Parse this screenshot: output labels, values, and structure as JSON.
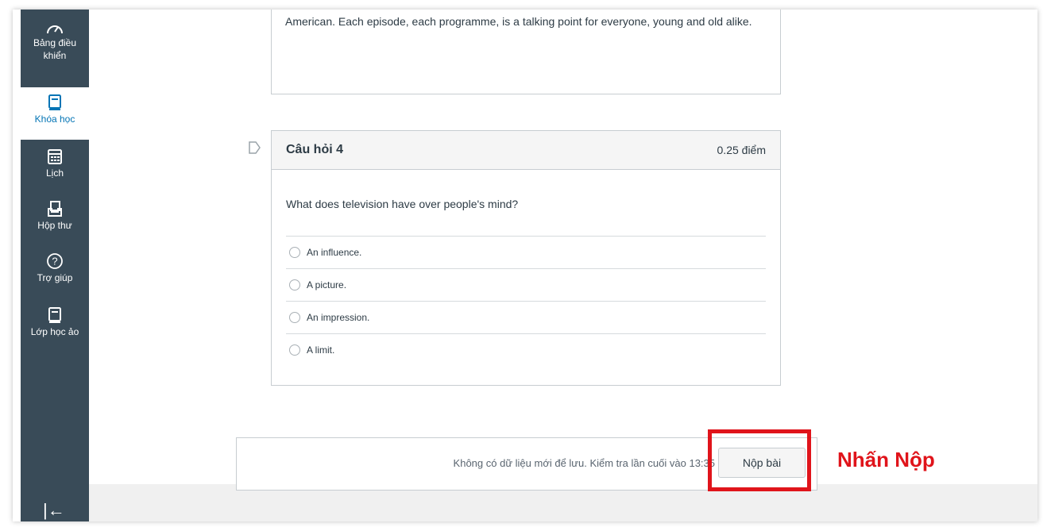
{
  "sidebar": {
    "items": [
      {
        "label": "Bảng điều khiển",
        "icon": "dashboard-icon"
      },
      {
        "label": "Khóa học",
        "icon": "courses-icon",
        "active": true
      },
      {
        "label": "Lịch",
        "icon": "calendar-icon"
      },
      {
        "label": "Hộp thư",
        "icon": "inbox-icon"
      },
      {
        "label": "Trợ giúp",
        "icon": "help-icon"
      },
      {
        "label": "Lớp học ảo",
        "icon": "virtual-class-icon"
      }
    ],
    "collapse_icon": "collapse-icon",
    "collapse_glyph": "|←"
  },
  "passage": {
    "text": "American. Each episode, each programme, is a talking point for everyone, young and old alike."
  },
  "question": {
    "title": "Câu hỏi 4",
    "points": "0.25 điểm",
    "text": "What does television have over people's mind?",
    "answers": [
      "An influence.",
      "A picture.",
      "An impression.",
      "A limit."
    ]
  },
  "footer": {
    "status": "Không có dữ liệu mới để lưu. Kiểm tra lần cuối vào 13:35",
    "submit_label": "Nộp bài"
  },
  "annotation": {
    "text": "Nhấn Nộp",
    "color": "#e0141b"
  },
  "colors": {
    "sidebar_bg": "#394b58",
    "active_text": "#0374b5"
  }
}
